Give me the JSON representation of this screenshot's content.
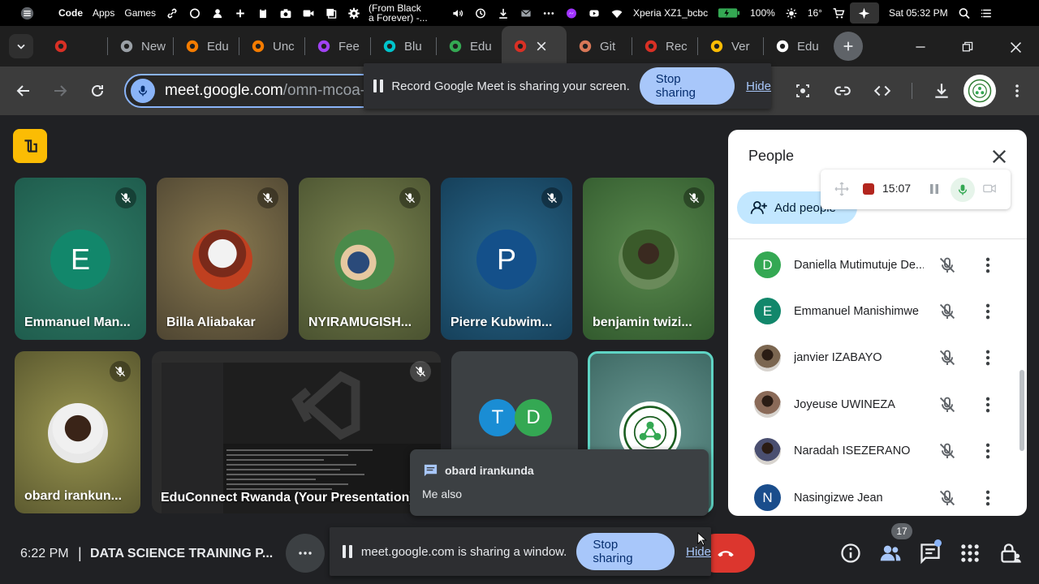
{
  "os_bar": {
    "app_name": "Code",
    "menu_apps": "Apps",
    "menu_games": "Games",
    "media_title_line1": "(From Black",
    "media_title_line2": "a Forever) -...",
    "network": "Xperia XZ1_bcbc",
    "battery": "100%",
    "brightness": "16°",
    "clock": "Sat 05:32 PM"
  },
  "tabs": [
    {
      "label": "",
      "favicon": "record-favicon",
      "color": "#d93025"
    },
    {
      "label": "New",
      "favicon": "chrome-favicon",
      "color": "#9aa0a6"
    },
    {
      "label": "Edu",
      "favicon": "fire-favicon",
      "color": "#f57c00"
    },
    {
      "label": "Unc",
      "favicon": "fire-favicon",
      "color": "#f57c00"
    },
    {
      "label": "Fee",
      "favicon": "v-favicon",
      "color": "#a142f4"
    },
    {
      "label": "Blu",
      "favicon": "canva-favicon",
      "color": "#00c4cc"
    },
    {
      "label": "Edu",
      "favicon": "drive-favicon",
      "color": "#34a853"
    },
    {
      "label": "",
      "favicon": "record-favicon",
      "color": "#d93025",
      "active": true
    },
    {
      "label": "Git",
      "favicon": "claude-favicon",
      "color": "#d97757"
    },
    {
      "label": "Rec",
      "favicon": "video-favicon",
      "color": "#d93025"
    },
    {
      "label": "Ver",
      "favicon": "note-favicon",
      "color": "#fbbc04"
    },
    {
      "label": "Edu",
      "favicon": "github-favicon",
      "color": "#ffffff"
    }
  ],
  "toolbar": {
    "url_main": "meet.google.com",
    "url_rest": "/omn-mcoa-b"
  },
  "share_top": {
    "message": "Record Google Meet is sharing your screen.",
    "stop_label": "Stop sharing",
    "hide_label": "Hide"
  },
  "share_bottom": {
    "message": "meet.google.com is sharing a window.",
    "stop_label": "Stop sharing",
    "hide_label": "Hide"
  },
  "tiles": [
    {
      "name": "Emmanuel Man...",
      "initial": "E",
      "bg": "#2b6e5c"
    },
    {
      "name": "Billa Aliabakar",
      "bg": "#6b5a3a"
    },
    {
      "name": "NYIRAMUGISH...",
      "bg": "#5e6a3a"
    },
    {
      "name": "Pierre Kubwim...",
      "initial": "P",
      "bg": "#1f4f6b"
    },
    {
      "name": "benjamin twizi...",
      "bg": "#3d6a3a"
    },
    {
      "name": "obard irankun...",
      "bg": "#7b7a40"
    },
    {
      "name": "EduConnect Rwanda (Your Presentation)",
      "bg": "#1e1e1e"
    },
    {
      "initials": [
        "T",
        "D"
      ],
      "bg": "#3c4043"
    },
    {
      "bg": "#5a8a86"
    }
  ],
  "people_panel": {
    "title": "People",
    "add_label": "Add people",
    "recording_time": "15:07",
    "people": [
      {
        "name": "Daniella Mutimutuje De...",
        "initial": "D",
        "color": "#34a853"
      },
      {
        "name": "Emmanuel Manishimwe",
        "initial": "E",
        "color": "#12876b"
      },
      {
        "name": "janvier IZABAYO",
        "photo": true,
        "color": "#7b6650"
      },
      {
        "name": "Joyeuse UWINEZA",
        "photo": true,
        "color": "#8a6a58"
      },
      {
        "name": "Naradah ISEZERANO",
        "photo": true,
        "color": "#4a4f70"
      },
      {
        "name": "Nasingizwe Jean",
        "initial": "N",
        "color": "#1a4d8c"
      }
    ]
  },
  "chat_toast": {
    "sender": "obard irankunda",
    "message": "Me also"
  },
  "bottom_bar": {
    "time": "6:22 PM",
    "separator": "|",
    "meeting_title": "DATA SCIENCE TRAINING P...",
    "participant_count": "17"
  },
  "colors": {
    "accent_blue": "#8ab4f8",
    "stop_button": "#a8c7fa",
    "end_call_red": "#dc362e",
    "meet_bg": "#202124",
    "logo_yellow": "#fbbc04"
  }
}
